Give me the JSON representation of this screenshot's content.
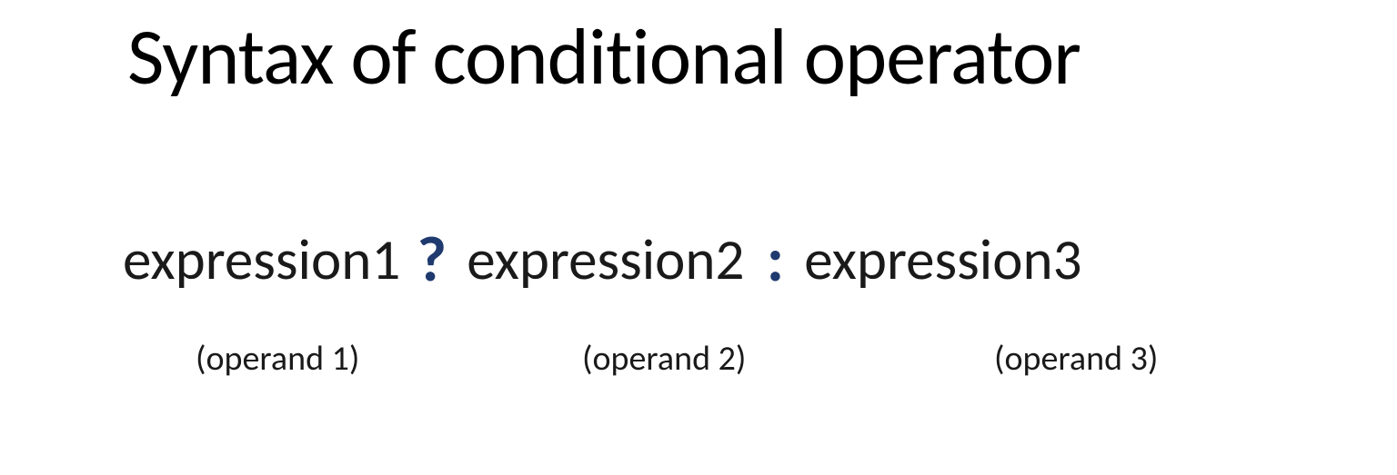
{
  "title": "Syntax of conditional operator",
  "syntax": {
    "expr1": "expression1",
    "question": "?",
    "expr2": "expression2",
    "colon": ":",
    "expr3": "expression3"
  },
  "labels": {
    "operand1": "(operand 1)",
    "operand2": "(operand 2)",
    "operand3": "(operand 3)"
  }
}
